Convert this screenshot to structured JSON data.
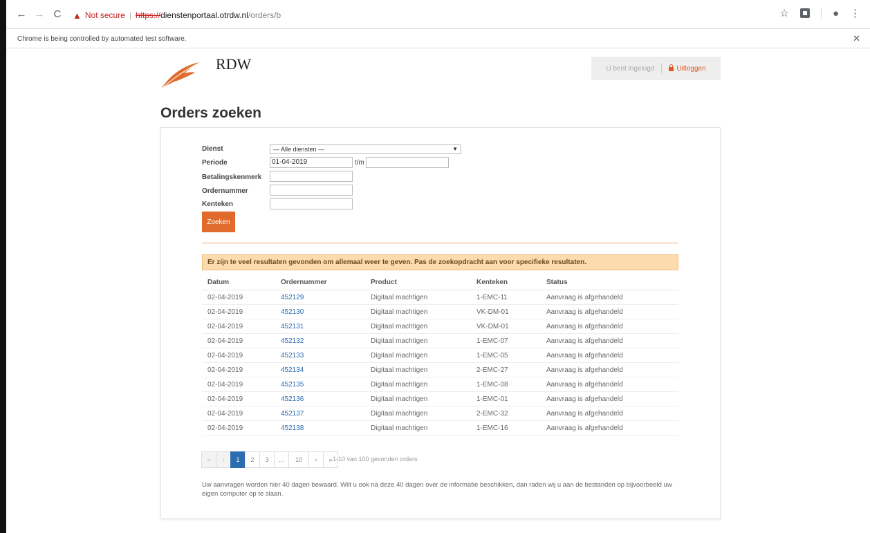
{
  "browser": {
    "security_label": "Not secure",
    "url_scheme": "https://",
    "url_host": "dienstenportaal.otrdw.nl",
    "url_path": "/orders/b",
    "infobar_text": "Chrome is being controlled by automated test software."
  },
  "header": {
    "brand": "RDW",
    "brand_color": "#e06b2c",
    "logged_in_text": "U bent ingelogd",
    "logout_label": "Uitloggen"
  },
  "page": {
    "title": "Orders zoeken"
  },
  "form": {
    "dienst_label": "Dienst",
    "dienst_value": "— Alle diensten —",
    "periode_label": "Periode",
    "periode_from": "01-04-2019",
    "periode_sep": "t/m",
    "periode_to": "",
    "betalingskenmerk_label": "Betalingskenmerk",
    "betalingskenmerk_value": "",
    "ordernummer_label": "Ordernummer",
    "ordernummer_value": "",
    "kenteken_label": "Kenteken",
    "kenteken_value": "",
    "search_button": "Zoeken"
  },
  "alert": {
    "text": "Er zijn te veel resultaten gevonden om allemaal weer te geven. Pas de zoekopdracht aan voor specifieke resultaten."
  },
  "table": {
    "headers": [
      "Datum",
      "Ordernummer",
      "Product",
      "Kenteken",
      "Status"
    ],
    "rows": [
      [
        "02-04-2019",
        "452129",
        "Digitaal machtigen",
        "1-EMC-11",
        "Aanvraag is afgehandeld"
      ],
      [
        "02-04-2019",
        "452130",
        "Digitaal machtigen",
        "VK-DM-01",
        "Aanvraag is afgehandeld"
      ],
      [
        "02-04-2019",
        "452131",
        "Digitaal machtigen",
        "VK-DM-01",
        "Aanvraag is afgehandeld"
      ],
      [
        "02-04-2019",
        "452132",
        "Digitaal machtigen",
        "1-EMC-07",
        "Aanvraag is afgehandeld"
      ],
      [
        "02-04-2019",
        "452133",
        "Digitaal machtigen",
        "1-EMC-05",
        "Aanvraag is afgehandeld"
      ],
      [
        "02-04-2019",
        "452134",
        "Digitaal machtigen",
        "2-EMC-27",
        "Aanvraag is afgehandeld"
      ],
      [
        "02-04-2019",
        "452135",
        "Digitaal machtigen",
        "1-EMC-08",
        "Aanvraag is afgehandeld"
      ],
      [
        "02-04-2019",
        "452136",
        "Digitaal machtigen",
        "1-EMC-01",
        "Aanvraag is afgehandeld"
      ],
      [
        "02-04-2019",
        "452137",
        "Digitaal machtigen",
        "2-EMC-32",
        "Aanvraag is afgehandeld"
      ],
      [
        "02-04-2019",
        "452138",
        "Digitaal machtigen",
        "1-EMC-16",
        "Aanvraag is afgehandeld"
      ]
    ]
  },
  "pagination": {
    "first": "«",
    "prev": "‹",
    "pages": [
      "1",
      "2",
      "3",
      "...",
      "10"
    ],
    "active_page": "1",
    "next": "›",
    "last": "»",
    "summary": "1-10 van 100 gevonden orders"
  },
  "footnote": "Uw aanvragen worden hier 40 dagen bewaard. Wilt u ook na deze 40 dagen over de informatie beschikken, dan raden wij u aan de bestanden op bijvoorbeeld uw eigen computer op te slaan."
}
